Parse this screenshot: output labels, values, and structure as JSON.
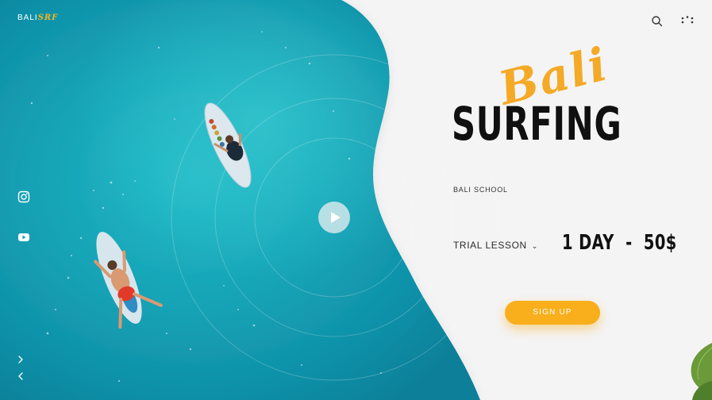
{
  "logo": {
    "text": "BALI",
    "accent": "SRF"
  },
  "header": {
    "icons": [
      "search-icon",
      "menu-dots-icon"
    ]
  },
  "social": [
    "instagram-icon",
    "youtube-icon"
  ],
  "nav": [
    "chevron-right-icon",
    "chevron-left-icon"
  ],
  "hero": {
    "script": "Bali",
    "title": "SURFING",
    "subtitle": "BALI SCHOOL"
  },
  "offer": {
    "trial_label": "TRIAL LESSON",
    "trial_caret": "⌄",
    "price": "1 DAY  -  50$"
  },
  "cta": {
    "signup_label": "SIGN UP"
  },
  "colors": {
    "accent": "#f9ae1b",
    "ocean": "#1aa8b9",
    "panel": "#f4f4f4",
    "text": "#101010"
  }
}
